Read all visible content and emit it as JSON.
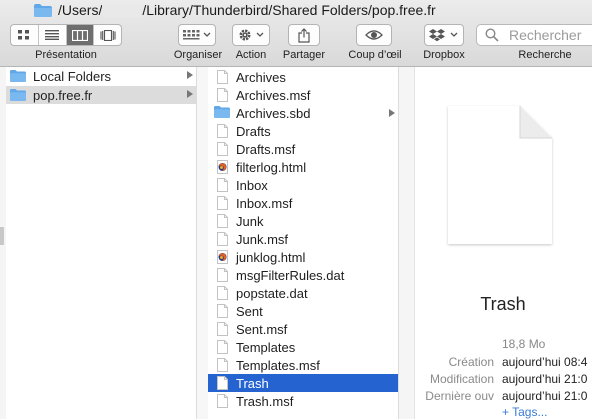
{
  "window": {
    "title_path_part1": "/Users/",
    "title_path_part2": "/Library/Thunderbird/Shared Folders/pop.free.fr"
  },
  "toolbar": {
    "presentation_label": "Présentation",
    "organiser_label": "Organiser",
    "action_label": "Action",
    "partager_label": "Partager",
    "coup_doeil_label": "Coup d’œil",
    "dropbox_label": "Dropbox",
    "search_label": "Recherche",
    "search_placeholder": "Rechercher"
  },
  "sidebar_column": {
    "items": [
      {
        "label": "Local Folders",
        "selected": false
      },
      {
        "label": "pop.free.fr",
        "selected": true
      }
    ]
  },
  "file_column": {
    "items": [
      {
        "label": "Archives",
        "icon": "document-icon"
      },
      {
        "label": "Archives.msf",
        "icon": "document-icon"
      },
      {
        "label": "Archives.sbd",
        "icon": "folder-icon"
      },
      {
        "label": "Drafts",
        "icon": "document-icon"
      },
      {
        "label": "Drafts.msf",
        "icon": "document-icon"
      },
      {
        "label": "filterlog.html",
        "icon": "firefox-html-icon"
      },
      {
        "label": "Inbox",
        "icon": "document-icon"
      },
      {
        "label": "Inbox.msf",
        "icon": "document-icon"
      },
      {
        "label": "Junk",
        "icon": "document-icon"
      },
      {
        "label": "Junk.msf",
        "icon": "document-icon"
      },
      {
        "label": "junklog.html",
        "icon": "firefox-html-icon"
      },
      {
        "label": "msgFilterRules.dat",
        "icon": "document-icon"
      },
      {
        "label": "popstate.dat",
        "icon": "document-icon"
      },
      {
        "label": "Sent",
        "icon": "document-icon"
      },
      {
        "label": "Sent.msf",
        "icon": "document-icon"
      },
      {
        "label": "Templates",
        "icon": "document-icon"
      },
      {
        "label": "Templates.msf",
        "icon": "document-icon"
      },
      {
        "label": "Trash",
        "icon": "document-icon",
        "selected": true
      },
      {
        "label": "Trash.msf",
        "icon": "document-icon"
      }
    ]
  },
  "preview": {
    "name": "Trash",
    "size": "18,8 Mo",
    "creation_label": "Création",
    "creation_value": "aujourd’hui 08:4",
    "modification_label": "Modification",
    "modification_value": "aujourd’hui 21:0",
    "last_opened_label": "Dernière ouv",
    "last_opened_value": "aujourd’hui 21:0",
    "tags_link": "+ Tags..."
  },
  "colors": {
    "selection": "#2563d1",
    "folder": "#62a7e8",
    "inactive_selection": "#dcdcdc"
  }
}
